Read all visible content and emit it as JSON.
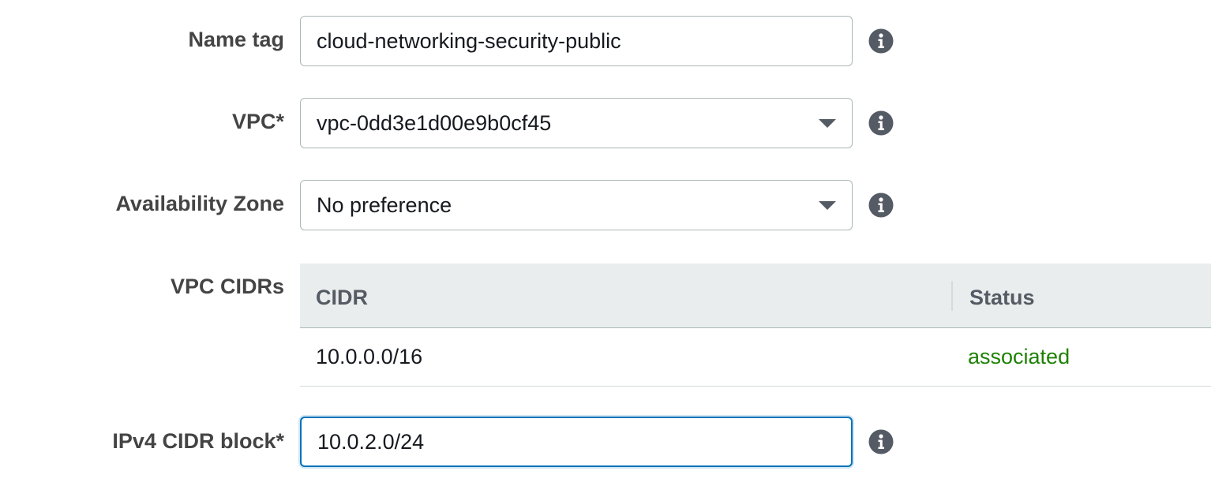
{
  "form": {
    "name_tag": {
      "label": "Name tag",
      "value": "cloud-networking-security-public",
      "icon": "info-icon"
    },
    "vpc": {
      "label": "VPC*",
      "selected": "vpc-0dd3e1d00e9b0cf45",
      "icon": "info-icon"
    },
    "availability_zone": {
      "label": "Availability Zone",
      "selected": "No preference",
      "icon": "info-icon"
    },
    "vpc_cidrs": {
      "label": "VPC CIDRs",
      "columns": [
        "CIDR",
        "Status"
      ],
      "rows": [
        {
          "cidr": "10.0.0.0/16",
          "status": "associated"
        }
      ]
    },
    "ipv4_cidr_block": {
      "label": "IPv4 CIDR block*",
      "value": "10.0.2.0/24",
      "icon": "info-icon"
    }
  },
  "colors": {
    "label_text": "#444444",
    "field_border": "#aab7b8",
    "focus_border": "#0073bb",
    "table_header_bg": "#eaeded",
    "status_associated": "#1d8102",
    "info_icon": "#545b64"
  }
}
